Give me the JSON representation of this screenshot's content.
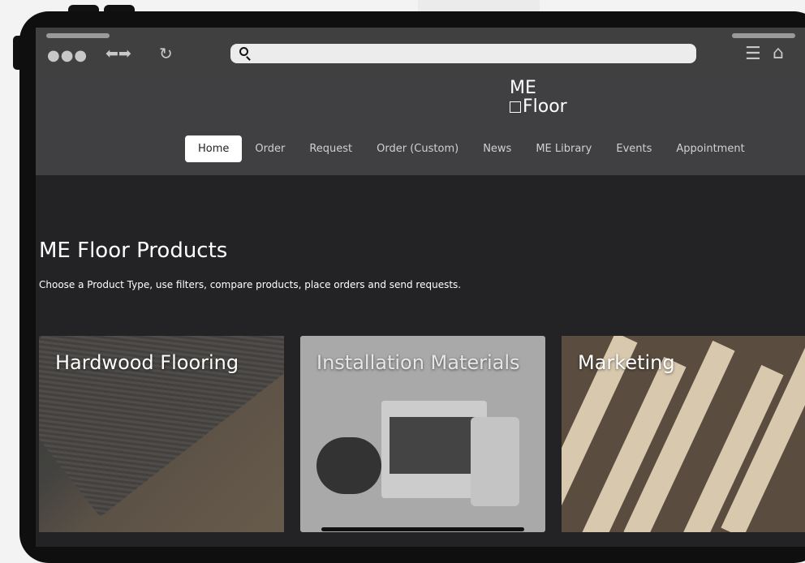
{
  "browser": {
    "url": "",
    "dots": "●●●",
    "arrows": "⬅➡",
    "reload": "↻",
    "menu_glyph": "☰",
    "home_glyph": "⌂"
  },
  "brand": {
    "line1": "ME",
    "line2": "Floor"
  },
  "nav": {
    "items": [
      "Home",
      "Order",
      "Request",
      "Order (Custom)",
      "News",
      "ME Library",
      "Events",
      "Appointment"
    ],
    "active": "Home"
  },
  "main": {
    "title": "ME Floor Products",
    "subtitle": "Choose a Product Type, use filters, compare products, place orders and send requests."
  },
  "cards": [
    {
      "title": "Hardwood Flooring"
    },
    {
      "title": "Installation Materials"
    },
    {
      "title": "Marketing"
    }
  ],
  "colors": {
    "chrome": "#404040",
    "header": "#404043",
    "page": "#232325",
    "active_nav_bg": "#ffffff"
  }
}
